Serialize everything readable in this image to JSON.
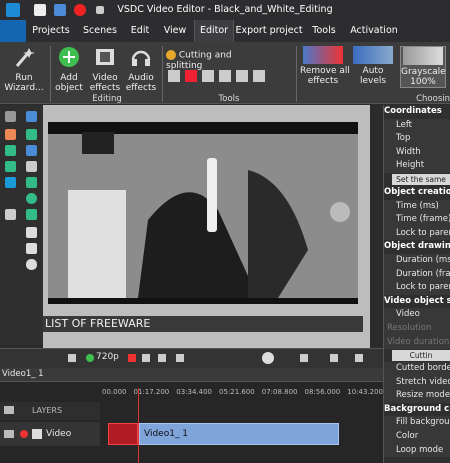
{
  "window": {
    "title": "VSDC Video Editor - Black_and_White_Editing"
  },
  "tabs": [
    "Projects",
    "Scenes",
    "Edit",
    "View",
    "Editor",
    "Export project",
    "Tools",
    "Activation"
  ],
  "active_tab": "Editor",
  "ribbon": {
    "run_wizard": "Run\nWizard...",
    "add_object": "Add\nobject",
    "video_effects": "Video\neffects",
    "audio_effects": "Audio\neffects",
    "editing_group": "Editing",
    "cutting": "Cutting and splitting",
    "tools_group": "Tools",
    "remove_all": "Remove all\neffects",
    "auto_levels": "Auto levels",
    "grayscale": "Grayscale\n100%",
    "choosing_group": "Choosin"
  },
  "canvas": {
    "caption": "LIST OF FREEWARE",
    "zoom": "720p"
  },
  "properties": {
    "rows": [
      {
        "t": "Coordinates",
        "k": "h"
      },
      {
        "t": "Left",
        "k": "i"
      },
      {
        "t": "Top",
        "k": "i"
      },
      {
        "t": "Width",
        "k": "i"
      },
      {
        "t": "Height",
        "k": "i"
      },
      {
        "t": "Set the same",
        "k": "btn"
      },
      {
        "t": "Object creatio",
        "k": "h"
      },
      {
        "t": "Time (ms)",
        "k": "i"
      },
      {
        "t": "Time (frame)",
        "k": "i"
      },
      {
        "t": "Lock to parent",
        "k": "i"
      },
      {
        "t": "Object drawin",
        "k": "h"
      },
      {
        "t": "Duration (ms)",
        "k": "i"
      },
      {
        "t": "Duration (fram",
        "k": "i"
      },
      {
        "t": "Lock to parent",
        "k": "i"
      },
      {
        "t": "Video object set",
        "k": "h"
      },
      {
        "t": "Video",
        "k": "i"
      },
      {
        "t": "Resolution",
        "k": "d"
      },
      {
        "t": "Video duration",
        "k": "d"
      },
      {
        "t": "Cuttin",
        "k": "btn"
      },
      {
        "t": "Cutted borders",
        "k": "i"
      },
      {
        "t": "Stretch video",
        "k": "i"
      },
      {
        "t": "Resize mode",
        "k": "i"
      },
      {
        "t": "Background c",
        "k": "h"
      },
      {
        "t": "Fill backgroun",
        "k": "i"
      },
      {
        "t": "Color",
        "k": "i"
      },
      {
        "t": "Loop mode",
        "k": "i"
      }
    ]
  },
  "timeline": {
    "tab": "Video1_ 1",
    "ruler": [
      "00.000",
      "01:17.200",
      "03:34.400",
      "05:21.600",
      "07:08.800",
      "08:56.000",
      "10:43.200"
    ],
    "layers_label": "LAYERS",
    "track_label": "Video",
    "clip_label": "Video1_ 1"
  },
  "colors": {
    "accent": "#007acc",
    "clip_red": "#b01c23",
    "clip_blue": "#7ea4da"
  }
}
